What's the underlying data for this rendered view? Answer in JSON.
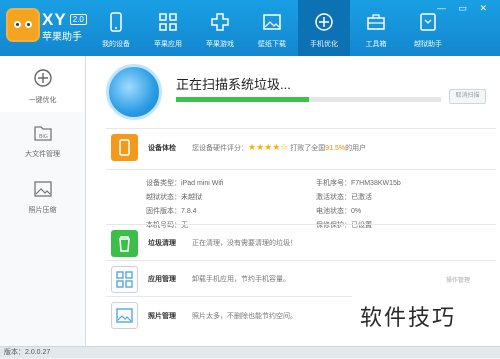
{
  "app": {
    "brand": "XY",
    "version": "2.0",
    "subtitle": "苹果助手"
  },
  "window_controls": "— ▭ ✕",
  "nav": [
    {
      "label": "我的设备",
      "icon": "phone-icon"
    },
    {
      "label": "苹果应用",
      "icon": "apps-icon"
    },
    {
      "label": "苹果游戏",
      "icon": "game-icon"
    },
    {
      "label": "壁纸下载",
      "icon": "picture-icon"
    },
    {
      "label": "手机优化",
      "icon": "optimize-icon"
    },
    {
      "label": "工具箱",
      "icon": "toolbox-icon"
    },
    {
      "label": "越狱助手",
      "icon": "jailbreak-icon"
    }
  ],
  "sidebar": [
    {
      "label": "一键优化",
      "icon": "plus-circle-icon"
    },
    {
      "label": "大文件管理",
      "icon": "folder-icon"
    },
    {
      "label": "照片压缩",
      "icon": "photo-icon"
    }
  ],
  "scan": {
    "title": "正在扫描系统垃圾...",
    "progress": 0.5,
    "cancel": "取消扫描"
  },
  "health": {
    "title": "设备体检",
    "prefix": "您设备硬件评分：",
    "stars": "★★★★☆",
    "suffix_a": "打败了全国",
    "percent": "91.5%",
    "suffix_b": "的用户"
  },
  "device_info": {
    "model": "设备类型：iPad mini Wifi",
    "serial": "手机序号：F7HM38KW15b",
    "jailbreak": "越狱状态：未越狱",
    "activation": "激活状态：已激活",
    "firmware": "固件版本：7.8.4",
    "battery": "电池状态：0%",
    "phone": "本机号码：无",
    "warranty": "保修保护：已设置"
  },
  "rows": {
    "junk": {
      "title": "垃圾清理",
      "desc": "正在清理，没有需要清理的垃圾！"
    },
    "apps": {
      "title": "应用管理",
      "desc": "卸载手机应用，节约手机容量。",
      "link": "操作管理"
    },
    "photos": {
      "title": "照片管理",
      "desc": "照片太多，不删除也能节约空间。"
    }
  },
  "status": "版本：2.0.0.27",
  "watermark": "软件技巧",
  "colors": {
    "topbar": "#1a9fe4",
    "progress": "#3ec24b",
    "health_icon": "#f39a1c",
    "junk_icon": "#3cbf4a"
  }
}
